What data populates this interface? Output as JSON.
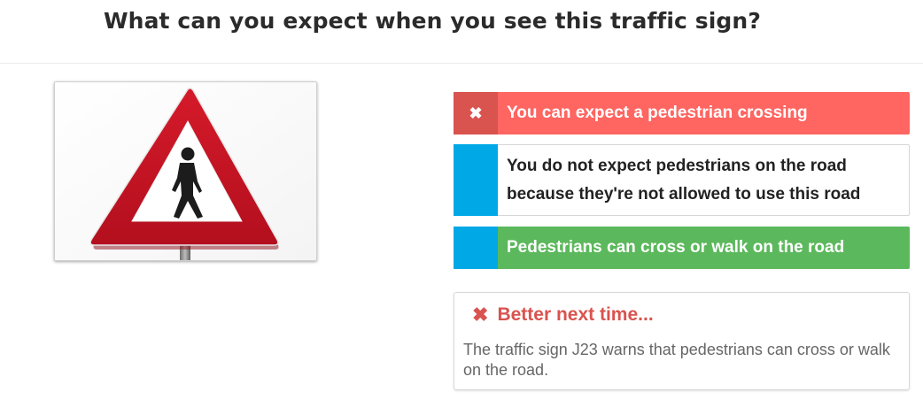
{
  "question": {
    "title": "What can you expect when you see this traffic sign?"
  },
  "sign_image": {
    "description_icon": "pedestrian-warning-sign-icon",
    "colors": {
      "border": "#c8102e",
      "inner": "#ffffff",
      "figure": "#1a1a1a"
    }
  },
  "answers": [
    {
      "marker_icon": "close-icon",
      "marker_glyph": "✖",
      "label": "You can expect a pedestrian crossing",
      "state": "selected-wrong",
      "color": "#ff6561"
    },
    {
      "marker_icon": "",
      "marker_glyph": "",
      "label": "You do not expect pedestrians on the road because they're not allowed to use this road",
      "state": "unselected",
      "color": "#ffffff"
    },
    {
      "marker_icon": "",
      "marker_glyph": "",
      "label": "Pedestrians can cross or walk on the road",
      "state": "correct",
      "color": "#5cb85c"
    }
  ],
  "feedback": {
    "icon": "close-icon",
    "icon_glyph": "✖",
    "heading": "Better next time...",
    "text": "The traffic sign J23 warns that pedestrians can cross or walk on the road.",
    "color": "#d9534f"
  }
}
